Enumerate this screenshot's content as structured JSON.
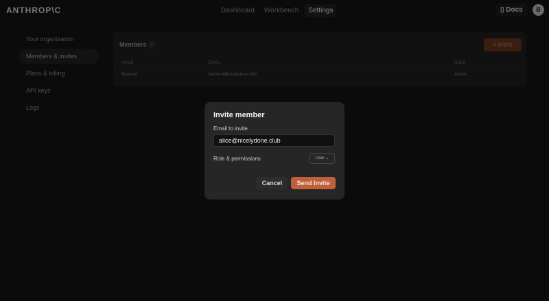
{
  "header": {
    "logo": "ANTHROP\\C",
    "nav": [
      "Dashboard",
      "Workbench",
      "Settings"
    ],
    "active": "Settings",
    "docs": "Docs",
    "avatar": "B"
  },
  "sidebar": {
    "items": [
      "Your organization",
      "Members & invites",
      "Plans & billing",
      "API keys",
      "Logs"
    ],
    "active": "Members & invites"
  },
  "members": {
    "title": "Members",
    "count": "1",
    "invite": "+ Invite",
    "columns": [
      "NAME",
      "EMAIL",
      "ROLE"
    ],
    "rows": [
      {
        "name": "Bertrand",
        "email": "bertrand@nicelydone.club",
        "role": "Admin"
      }
    ]
  },
  "modal": {
    "title": "Invite member",
    "email_label": "Email to invite",
    "email_value": "alice@nicelydone.club",
    "role_label": "Role & permissions",
    "role_value": "User ⌄",
    "cancel": "Cancel",
    "send": "Send Invite"
  },
  "colors": {
    "accent": "#c0603a"
  }
}
